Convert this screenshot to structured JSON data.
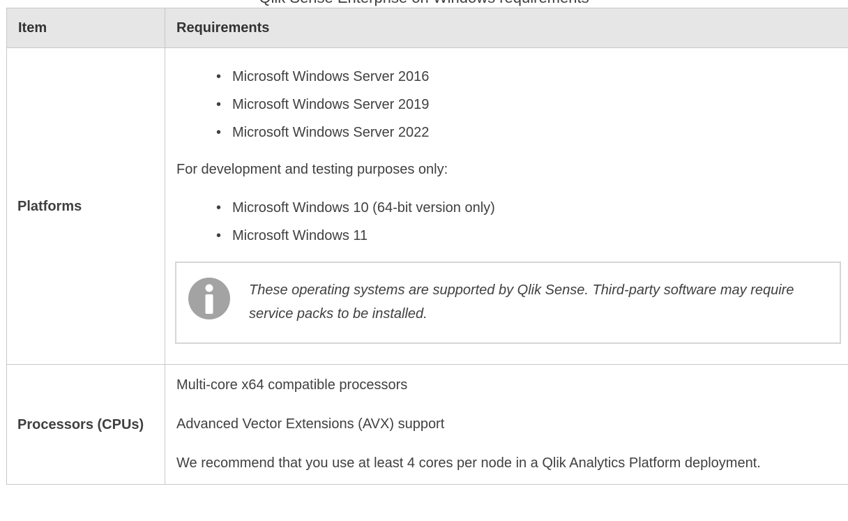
{
  "caption": "Qlik Sense Enterprise on Windows requirements",
  "table": {
    "headers": [
      "Item",
      "Requirements"
    ],
    "platforms": {
      "item": "Platforms",
      "server_list": [
        "Microsoft Windows Server 2016",
        "Microsoft Windows Server 2019",
        "Microsoft Windows Server 2022"
      ],
      "dev_intro": "For development and testing purposes only:",
      "dev_list": [
        "Microsoft Windows 10 (64-bit version only)",
        "Microsoft Windows 11"
      ],
      "note_icon": "info-icon",
      "note_color": "#a3a3a3",
      "note": "These operating systems are supported by Qlik Sense. Third-party software may require service packs to be installed."
    },
    "processors": {
      "item": "Processors (CPUs)",
      "lines": [
        "Multi-core x64 compatible processors",
        "Advanced Vector Extensions (AVX) support",
        "We recommend that you use at least 4 cores per node in a Qlik Analytics Platform deployment."
      ]
    }
  },
  "colors": {
    "header_bg": "#e6e6e6",
    "border": "#c8c8c8",
    "text": "#404040"
  }
}
